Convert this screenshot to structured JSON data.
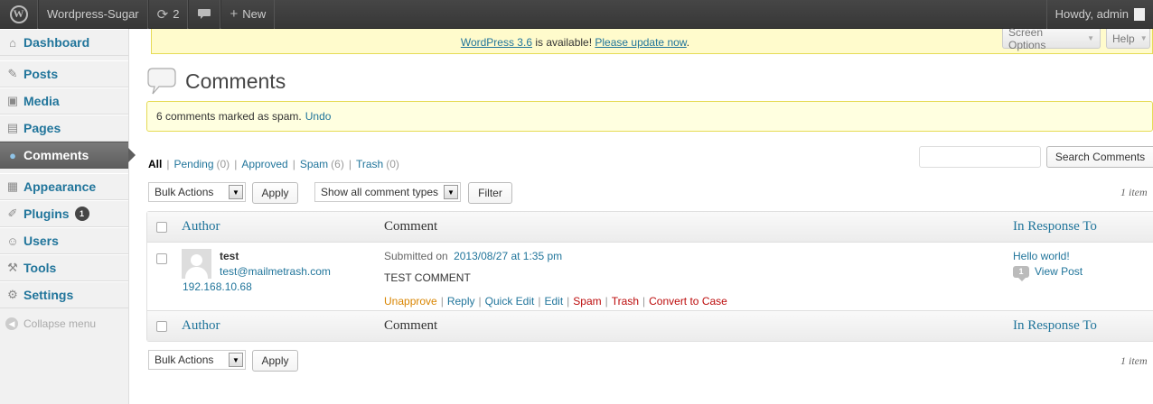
{
  "adminbar": {
    "site_name": "Wordpress-Sugar",
    "updates_count": "2",
    "new_label": "New",
    "howdy": "Howdy, admin"
  },
  "sidebar": {
    "items": [
      {
        "label": "Dashboard",
        "icon": "home-icon"
      },
      {
        "label": "Posts",
        "icon": "pin-icon"
      },
      {
        "label": "Media",
        "icon": "media-icon"
      },
      {
        "label": "Pages",
        "icon": "page-icon"
      },
      {
        "label": "Comments",
        "icon": "comment-icon",
        "current": true
      },
      {
        "label": "Appearance",
        "icon": "appearance-icon"
      },
      {
        "label": "Plugins",
        "icon": "plugin-icon",
        "badge": "1"
      },
      {
        "label": "Users",
        "icon": "users-icon"
      },
      {
        "label": "Tools",
        "icon": "tools-icon"
      },
      {
        "label": "Settings",
        "icon": "settings-icon"
      }
    ],
    "collapse_label": "Collapse menu"
  },
  "nag": {
    "version_link": "WordPress 3.6",
    "middle": " is available! ",
    "update_link": "Please update now",
    "end": "."
  },
  "screen_meta": {
    "screen_options": "Screen Options",
    "help": "Help"
  },
  "page": {
    "title": "Comments"
  },
  "notice": {
    "text": "6 comments marked as spam.",
    "undo": "Undo"
  },
  "filters": {
    "all": "All",
    "pending": "Pending",
    "pending_count": "(0)",
    "approved": "Approved",
    "spam": "Spam",
    "spam_count": "(6)",
    "trash": "Trash",
    "trash_count": "(0)",
    "sep": "|"
  },
  "search": {
    "value": "",
    "button": "Search Comments"
  },
  "toolbar": {
    "bulk_actions": "Bulk Actions",
    "apply": "Apply",
    "comment_types": "Show all comment types",
    "filter": "Filter",
    "item_count": "1 item"
  },
  "table": {
    "headers": {
      "author": "Author",
      "comment": "Comment",
      "response": "In Response To"
    },
    "rows": [
      {
        "author_name": "test",
        "author_email": "test@mailmetrash.com",
        "author_ip": "192.168.10.68",
        "submitted_prefix": "Submitted on",
        "submitted_date": "2013/08/27 at 1:35 pm",
        "comment_text": "TEST COMMENT",
        "actions": {
          "unapprove": "Unapprove",
          "reply": "Reply",
          "quick_edit": "Quick Edit",
          "edit": "Edit",
          "spam": "Spam",
          "trash": "Trash",
          "convert": "Convert to Case"
        },
        "post_title": "Hello world!",
        "post_comment_count": "1",
        "view_post": "View Post"
      }
    ]
  }
}
